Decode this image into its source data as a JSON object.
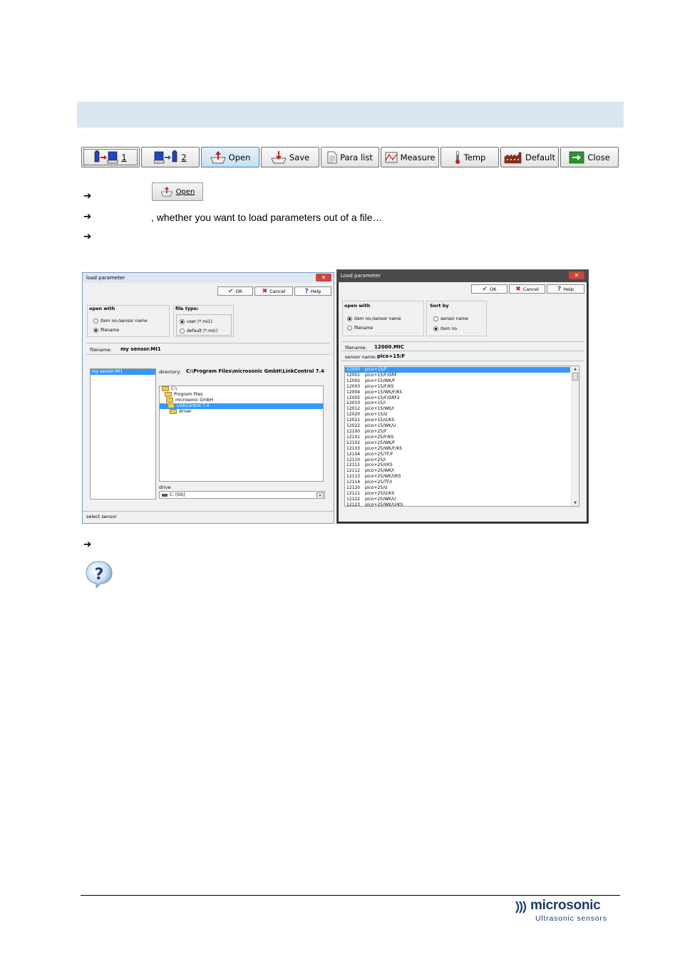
{
  "toolbar": {
    "buttons": [
      {
        "label": "1",
        "icon": "sensor-to-screen-icon"
      },
      {
        "label": "2",
        "icon": "screen-to-sensor-icon"
      },
      {
        "label": "Open",
        "icon": "open-icon"
      },
      {
        "label": "Save",
        "icon": "save-icon"
      },
      {
        "label": "Para list",
        "icon": "document-icon"
      },
      {
        "label": "Measure",
        "icon": "graph-icon"
      },
      {
        "label": "Temp",
        "icon": "thermometer-icon"
      },
      {
        "label": "Default",
        "icon": "factory-icon"
      },
      {
        "label": "Close",
        "icon": "exit-icon"
      }
    ]
  },
  "steps": {
    "mini_open_label": "Open",
    "line2": ", whether you want to load parameters out of a file…"
  },
  "dialog_a": {
    "title": "load parameter",
    "ok": "OK",
    "cancel": "Cancel",
    "help": "Help",
    "open_with": "open with",
    "opt_item": "item no./sensor name",
    "opt_file": "filename",
    "file_type": "file type:",
    "type_user": "user (*.mi1)",
    "type_default": "default (*.mic)",
    "filename_label": "filename:",
    "filename_value": "my sensor.MI1",
    "file_list": [
      "my sensor.MI1"
    ],
    "directory_label": "directory:",
    "directory_value": "C:\\Program Files\\microsonic GmbH\\LinkControl 7.4",
    "folders": [
      "C:\\",
      "Program Files",
      "microsonic GmbH",
      "LinkControl 7.4",
      "driver"
    ],
    "drive_label": "drive",
    "drive_value": "C: [OS]",
    "status": "select sensor"
  },
  "dialog_b": {
    "title": "Load parameter",
    "ok": "OK",
    "cancel": "Cancel",
    "help": "Help",
    "open_with": "open with",
    "opt_item": "item no./sensor name",
    "opt_file": "filename",
    "sort_by": "Sort by",
    "sort_name": "sensor name",
    "sort_item": "item no.",
    "filename_label": "filename:",
    "filename_value": "12000.MIC",
    "sensor_label": "sensor name:",
    "sensor_value": "pico+15/F",
    "rows": [
      [
        "12000",
        "pico+15/F"
      ],
      [
        "12001",
        "pico+15/F/GRF"
      ],
      [
        "12002",
        "pico+15/WK/F"
      ],
      [
        "12003",
        "pico+15/F/KS"
      ],
      [
        "12004",
        "pico+15/WK/F/KS"
      ],
      [
        "12005",
        "pico+15/F/GRF2"
      ],
      [
        "12010",
        "pico+15/I"
      ],
      [
        "12012",
        "pico+15/WK/I"
      ],
      [
        "12020",
        "pico+15/U"
      ],
      [
        "12021",
        "pico+15/U/KS"
      ],
      [
        "12022",
        "pico+15/WK/U"
      ],
      [
        "12100",
        "pico+25/F"
      ],
      [
        "12101",
        "pico+25/F/KS"
      ],
      [
        "12102",
        "pico+25/WK/F"
      ],
      [
        "12103",
        "pico+25/WK/F/KS"
      ],
      [
        "12104",
        "pico+25/TF/F"
      ],
      [
        "12110",
        "pico+25/I"
      ],
      [
        "12111",
        "pico+25/I/KS"
      ],
      [
        "12112",
        "pico+25/WK/I"
      ],
      [
        "12113",
        "pico+25/WK/I/KS"
      ],
      [
        "12114",
        "pico+25/TF/I"
      ],
      [
        "12120",
        "pico+25/U"
      ],
      [
        "12121",
        "pico+25/U/KS"
      ],
      [
        "12122",
        "pico+25/WK/U"
      ],
      [
        "12123",
        "pico+25/WK/U/KS"
      ]
    ]
  },
  "logo": {
    "brand": "microsonic",
    "sub": "Ultrasonic sensors"
  }
}
